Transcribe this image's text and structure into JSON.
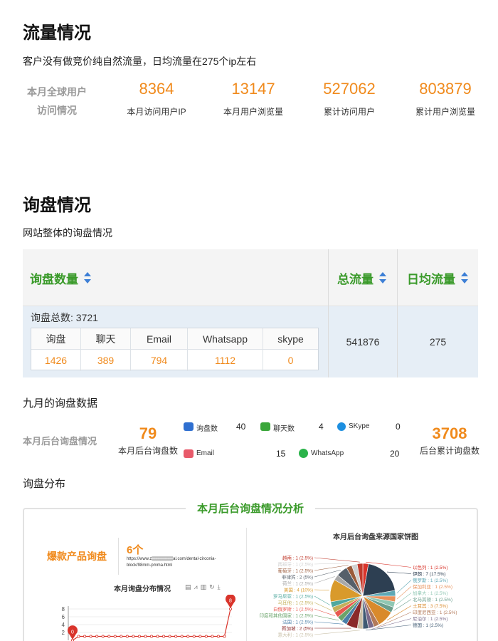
{
  "traffic": {
    "title": "流量情况",
    "description": "客户没有做竞价纯自然流量，日均流量在275个ip左右",
    "label_line1": "本月全球用户",
    "label_line2": "访问情况",
    "stats": [
      {
        "value": "8364",
        "label": "本月访问用户IP"
      },
      {
        "value": "13147",
        "label": "本月用户浏览量"
      },
      {
        "value": "527062",
        "label": "累计访问用户"
      },
      {
        "value": "803879",
        "label": "累计用户浏览量"
      }
    ]
  },
  "inquiry": {
    "title": "询盘情况",
    "description": "网站整体的询盘情况",
    "table": {
      "col1": "询盘数量",
      "col2": "总流量",
      "col3": "日均流量",
      "total_label": "询盘总数:  3721",
      "sub_headers": [
        "询盘",
        "聊天",
        "Email",
        "Whatsapp",
        "skype"
      ],
      "sub_values": [
        "1426",
        "389",
        "794",
        "1112",
        "0"
      ],
      "total_traffic": "541876",
      "daily_traffic": "275"
    }
  },
  "september": {
    "title": "九月的询盘数据",
    "label": "本月后台询盘情况",
    "month_count": "79",
    "month_count_label": "本月后台询盘数",
    "cumulative_count": "3708",
    "cumulative_label": "后台累计询盘数",
    "channels": [
      {
        "name": "询盘数",
        "value": "40",
        "color": "#2f6fd0"
      },
      {
        "name": "聊天数",
        "value": "4",
        "color": "#3aa63a"
      },
      {
        "name": "SKype",
        "value": "0",
        "color": "#1d8fe0"
      },
      {
        "name": "Email",
        "value": "15",
        "color": "#e85a6a"
      },
      {
        "name": "WhatsApp",
        "value": "20",
        "color": "#2bb34a"
      }
    ]
  },
  "distribution": {
    "title": "询盘分布",
    "panel_title": "本月后台询盘情况分析",
    "hot_label": "爆款产品询盘",
    "hot_count": "6个",
    "hot_url_line1": "https://www.z▒▒▒▒▒▒▒al.com/dental-zirconia-",
    "hot_url_line2": "block/98mm-pmma.html",
    "line_chart_title": "本月询盘分布情况",
    "pie_title": "本月后台询盘来源国家饼图"
  },
  "chart_data": [
    {
      "type": "line",
      "title": "本月询盘分布情况",
      "y_ticks": [
        "8",
        "6",
        "4",
        "2"
      ],
      "ylim": [
        0,
        8
      ],
      "max_marker": "8",
      "min_marker": "0",
      "values": [
        0,
        1,
        1,
        1,
        1,
        1,
        1,
        1,
        1,
        1,
        1,
        1,
        1,
        1,
        1,
        1,
        1,
        1,
        1,
        1,
        1,
        1,
        1,
        1,
        1,
        1,
        8
      ],
      "color": "#d9342b"
    },
    {
      "type": "pie",
      "title": "本月后台询盘来源国家饼图",
      "slices": [
        {
          "label": "以色列 : 1 (2.5%)",
          "value": 2.5,
          "color": "#d9342b"
        },
        {
          "label": "伊朗 : 7 (17.5%)",
          "value": 17.5,
          "color": "#2d3f52"
        },
        {
          "label": "俄罗斯 : 1 (2.5%)",
          "value": 2.5,
          "color": "#5fa8b5"
        },
        {
          "label": "保加利亚 : 1 (2.5%)",
          "value": 2.5,
          "color": "#e8915a"
        },
        {
          "label": "加拿大 : 1 (2.5%)",
          "value": 2.5,
          "color": "#8fc7b3"
        },
        {
          "label": "北马其顿 : 1 (2.5%)",
          "value": 2.5,
          "color": "#6b9e8c"
        },
        {
          "label": "土耳其 : 3 (7.5%)",
          "value": 7.5,
          "color": "#d98a2b"
        },
        {
          "label": "印度尼西亚 : 1 (2.5%)",
          "value": 2.5,
          "color": "#b37a5a"
        },
        {
          "label": "尼泊尔 : 1 (2.5%)",
          "value": 2.5,
          "color": "#7a6a8a"
        },
        {
          "label": "德国 : 1 (2.5%)",
          "value": 2.5,
          "color": "#3f5a73"
        },
        {
          "label": "意大利 : 1 (2.5%)",
          "value": 2.5,
          "color": "#c9c0a8"
        },
        {
          "label": "新加坡 : 2 (5%)",
          "value": 5,
          "color": "#8a2a2a"
        },
        {
          "label": "法国 : 1 (2.5%)",
          "value": 2.5,
          "color": "#4a7fa8"
        },
        {
          "label": "印度和其他国家 : 1 (2.5%)",
          "value": 2.5,
          "color": "#6aa36a"
        },
        {
          "label": "白俄罗斯 : 1 (2.5%)",
          "value": 2.5,
          "color": "#e85a4f"
        },
        {
          "label": "马耳他 : 1 (2.5%)",
          "value": 2.5,
          "color": "#c4b05a"
        },
        {
          "label": "罗马尼亚 : 1 (2.5%)",
          "value": 2.5,
          "color": "#4fa89e"
        },
        {
          "label": "美国 : 4 (10%)",
          "value": 10,
          "color": "#d99a2b"
        },
        {
          "label": "荷兰 : 1 (2.5%)",
          "value": 2.5,
          "color": "#a8a8a8"
        },
        {
          "label": "菲律宾 : 2 (5%)",
          "value": 5,
          "color": "#555f6a"
        },
        {
          "label": "葡萄牙 : 1 (2.5%)",
          "value": 2.5,
          "color": "#9a5a3a"
        },
        {
          "label": "西班牙 : 1 (2.5%)",
          "value": 2.5,
          "color": "#d0d0d0"
        },
        {
          "label": "越南 : 1 (2.5%)",
          "value": 2.5,
          "color": "#c0392b"
        }
      ]
    }
  ]
}
